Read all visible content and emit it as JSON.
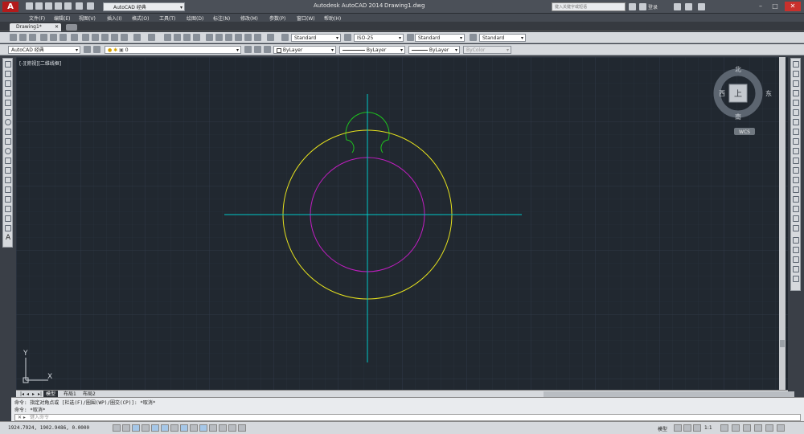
{
  "app": {
    "title": "Autodesk AutoCAD 2014",
    "document": "Drawing1.dwg",
    "logo": "A",
    "workspace": "AutoCAD 经典",
    "search_placeholder": "键入关键字或短语",
    "login": "登录",
    "accent": "#b31b1b"
  },
  "menu": [
    "文件(F)",
    "编辑(E)",
    "视图(V)",
    "插入(I)",
    "格式(O)",
    "工具(T)",
    "绘图(D)",
    "标注(N)",
    "修改(M)",
    "参数(P)",
    "窗口(W)",
    "帮助(H)"
  ],
  "tabs": {
    "active": "Drawing1*"
  },
  "toolbar1": {
    "text_style": "Standard",
    "dim_style": "ISO-25",
    "table_style": "Standard",
    "multileader_style": "Standard"
  },
  "toolbar2": {
    "workspace": "AutoCAD 经典",
    "layer": "0",
    "color": "ByLayer",
    "linetype": "ByLayer",
    "lineweight": "ByLayer",
    "plot_style": "ByColor"
  },
  "viewport": {
    "label": "[-][俯视][二维线框]",
    "viewcube": {
      "north": "北",
      "south": "南",
      "east": "东",
      "west": "西",
      "top": "上",
      "wcs": "WCS"
    },
    "ucs": {
      "x": "X",
      "y": "Y"
    }
  },
  "drawing": {
    "background": "#212830",
    "centerline_color": "#00c8c8",
    "outer_circle_color": "#e6e21e",
    "inner_circle_color": "#c21ec2",
    "knob_color": "#1ec21e"
  },
  "layout_tabs": [
    "模型",
    "布局1",
    "布局2"
  ],
  "command": {
    "history": [
      "命令: 指定对角点或 [栏选(F)/圈围(WP)/圈交(CP)]: *取消*",
      "命令: *取消*"
    ],
    "placeholder": "键入命令"
  },
  "status": {
    "coords": "1924.7924, 1902.9486, 0.0000",
    "model": "模型",
    "scale": "1:1"
  }
}
